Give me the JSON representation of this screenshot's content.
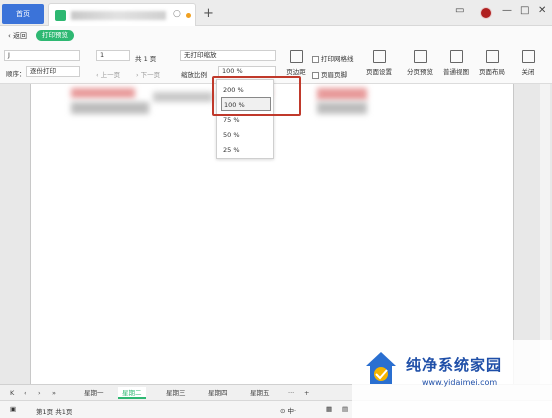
{
  "titlebar": {
    "home_tab": "首页",
    "new_tab": "+"
  },
  "toolbar": {
    "back_label": "返回",
    "print_preview_badge": "打印预览",
    "printer_value": "J",
    "order_label": "顺序：",
    "order_value": "逐份打印",
    "page_value": "1",
    "page_total": "共 1 页",
    "prev_page": "上一页",
    "next_page": "下一页",
    "scaling_value": "无打印缩放",
    "zoom_label": "缩放比例",
    "zoom_value": "100 %",
    "page_margin": "页边距",
    "print_gridlines": "打印网格线",
    "header_footer": "页眉页脚",
    "page_setup": "页面设置",
    "page_break_preview": "分页预览",
    "normal_view": "普通视图",
    "page_layout": "页面布局",
    "close": "关闭"
  },
  "zoom_dropdown": {
    "options": [
      "200 %",
      "100 %",
      "75 %",
      "50 %",
      "25 %"
    ],
    "selected_index": 1
  },
  "sheets": {
    "tabs": [
      "星期一",
      "星期二",
      "星期三",
      "星期四",
      "星期五"
    ],
    "active_index": 1,
    "more": "···",
    "add": "+"
  },
  "status": {
    "page_info": "第1页 共1页"
  },
  "watermark": {
    "title": "纯净系统家园",
    "url": "www.yidaimei.com"
  },
  "colors": {
    "accent_green": "#2eb872",
    "home_blue": "#3b73d9",
    "highlight_red": "#c0392b"
  }
}
